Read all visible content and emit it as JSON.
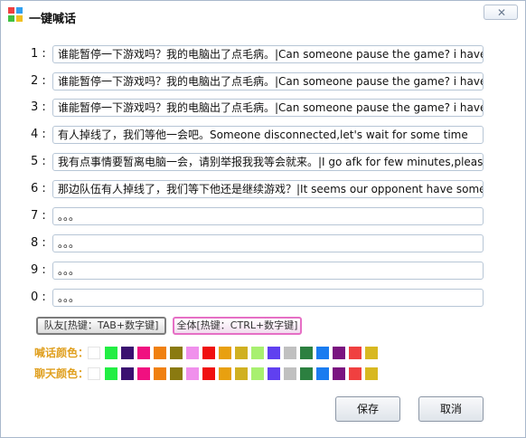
{
  "title": "一键喊话",
  "close_label": "✕",
  "rows": [
    {
      "label": "1 :",
      "value": "谁能暂停一下游戏吗？我的电脑出了点毛病。|Can someone pause the game? i have"
    },
    {
      "label": "2 :",
      "value": "谁能暂停一下游戏吗？我的电脑出了点毛病。|Can someone pause the game? i have"
    },
    {
      "label": "3 :",
      "value": "谁能暂停一下游戏吗？我的电脑出了点毛病。|Can someone pause the game? i have"
    },
    {
      "label": "4 :",
      "value": "有人掉线了，我们等他一会吧。Someone disconnected,let's wait for some time"
    },
    {
      "label": "5 :",
      "value": "我有点事情要暂离电脑一会，请别举报我我等会就来。|I go afk for few minutes,pleas"
    },
    {
      "label": "6 :",
      "value": "那边队伍有人掉线了，我们等下他还是继续游戏？|It seems our opponent have some"
    },
    {
      "label": "7 :",
      "value": "。。。"
    },
    {
      "label": "8 :",
      "value": "。。。"
    },
    {
      "label": "9 :",
      "value": "。。。"
    },
    {
      "label": "0 :",
      "value": "。。。"
    }
  ],
  "buttons": {
    "team": "队友[热键：TAB+数字键]",
    "all": "全体[热键：CTRL+数字键]",
    "save": "保存",
    "cancel": "取消"
  },
  "shout_color_label": "喊话颜色：",
  "chat_color_label": "聊天颜色：",
  "colors": {
    "shout_label": "#e0a020",
    "chat_label": "#e0a020",
    "palette": [
      "#ffffff",
      "#22ee44",
      "#3a1070",
      "#f01080",
      "#f08010",
      "#8a7a10",
      "#f090ec",
      "#f01010",
      "#e8a010",
      "#d0b020",
      "#a8f070",
      "#6040f0",
      "#c0c0c0",
      "#2c8040",
      "#1a7cf0",
      "#7a1480",
      "#f04040",
      "#d8b820"
    ]
  }
}
